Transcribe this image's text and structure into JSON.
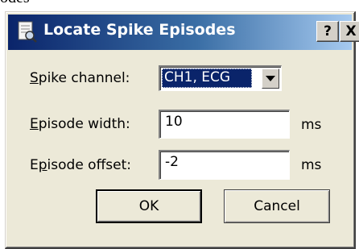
{
  "behind_text": "odes",
  "window": {
    "title": "Locate Spike Episodes",
    "help_label": "?",
    "close_label": "X"
  },
  "form": {
    "spike_channel": {
      "label_mnemonic": "S",
      "label_rest": "pike channel:",
      "value": "CH1, ECG"
    },
    "episode_width": {
      "label_mnemonic": "E",
      "label_rest": "pisode width:",
      "value": "10",
      "unit": "ms"
    },
    "episode_offset": {
      "label_pre": "E",
      "label_mnemonic": "p",
      "label_rest": "isode offset:",
      "value": "-2",
      "unit": "ms"
    }
  },
  "buttons": {
    "ok": "OK",
    "cancel": "Cancel"
  }
}
